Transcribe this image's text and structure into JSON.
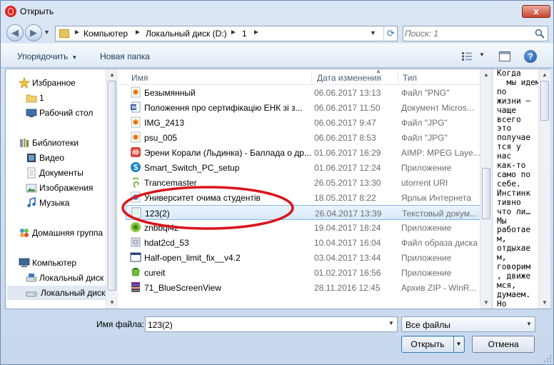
{
  "window": {
    "title": "Открыть",
    "close_label": "x"
  },
  "address": {
    "crumbs": [
      "Компьютер",
      "Локальный диск (D:)",
      "1"
    ],
    "search_placeholder": "Поиск: 1"
  },
  "toolbar": {
    "organize": "Упорядочить",
    "new_folder": "Новая папка"
  },
  "sidebar": {
    "items": [
      {
        "label": "Избранное",
        "icon": "star-icon"
      },
      {
        "label": "1",
        "icon": "folder-icon"
      },
      {
        "label": "Рабочий стол",
        "icon": "desktop-icon"
      },
      {
        "label": "Библиотеки",
        "icon": "library-icon"
      },
      {
        "label": "Видео",
        "icon": "video-icon"
      },
      {
        "label": "Документы",
        "icon": "documents-icon"
      },
      {
        "label": "Изображения",
        "icon": "pictures-icon"
      },
      {
        "label": "Музыка",
        "icon": "music-icon"
      },
      {
        "label": "Домашняя группа",
        "icon": "homegroup-icon"
      },
      {
        "label": "Компьютер",
        "icon": "computer-icon"
      },
      {
        "label": "Локальный диск",
        "icon": "drive-icon"
      },
      {
        "label": "Локальный диск",
        "icon": "drive-icon"
      }
    ]
  },
  "columns": {
    "name": "Имя",
    "date": "Дата изменения",
    "type": "Тип"
  },
  "files": [
    {
      "name": "Безымянный",
      "date": "06.06.2017 13:13",
      "type": "Файл \"PNG\"",
      "icon": "image-file-icon"
    },
    {
      "name": "Положення про сертифікацію ЕНК зі з...",
      "date": "06.06.2017 11:50",
      "type": "Документ Micros...",
      "icon": "word-doc-icon"
    },
    {
      "name": "IMG_2413",
      "date": "06.06.2017 9:47",
      "type": "Файл \"JPG\"",
      "icon": "image-file-icon"
    },
    {
      "name": "psu_005",
      "date": "06.06.2017 8:53",
      "type": "Файл \"JPG\"",
      "icon": "image-file-icon"
    },
    {
      "name": "Эрени Корали (Льдинка) - Баллада о др...",
      "date": "01.06.2017 16:29",
      "type": "AIMP: MPEG Laye...",
      "icon": "audio-file-icon"
    },
    {
      "name": "Smart_Switch_PC_setup",
      "date": "01.06.2017 12:24",
      "type": "Приложение",
      "icon": "smart-switch-icon"
    },
    {
      "name": "Trancemaster",
      "date": "26.05.2017 13:30",
      "type": "utorrent URI",
      "icon": "torrent-icon"
    },
    {
      "name": "Университет очима студентів",
      "date": "18.05.2017 8:22",
      "type": "Ярлык Интернета",
      "icon": "internet-shortcut-icon"
    },
    {
      "name": "123(2)",
      "date": "26.04.2017 13:39",
      "type": "Текстовый докум...",
      "icon": "text-file-icon"
    },
    {
      "name": "znbbql4z",
      "date": "19.04.2017 18:24",
      "type": "Приложение",
      "icon": "app-icon"
    },
    {
      "name": "hdat2cd_53",
      "date": "10.04.2017 16:04",
      "type": "Файл образа диска",
      "icon": "disc-image-icon"
    },
    {
      "name": "Half-open_limit_fix__v4.2",
      "date": "03.04.2017 13:44",
      "type": "Приложение",
      "icon": "exe-icon"
    },
    {
      "name": "cureit",
      "date": "01.02.2017 16:56",
      "type": "Приложение",
      "icon": "cureit-icon"
    },
    {
      "name": "71_BlueScreenView",
      "date": "28.11.2016 12:45",
      "type": "Архив ZIP - WinR...",
      "icon": "archive-icon"
    }
  ],
  "preview": {
    "lines": [
      "Когда",
      "  мы идем",
      "по",
      "жизни –",
      "чаще",
      "всего",
      "это",
      "получае",
      "тся у",
      "нас",
      "как-то",
      "само по",
      "себе.",
      "Инстинк",
      "тивно",
      "что ли…",
      "Мы",
      "работае",
      "м,",
      "отдыхае",
      "м,",
      "говорим",
      ", движе",
      "мся,",
      "думаем.",
      "Но"
    ]
  },
  "footer": {
    "filename_label": "Имя файла:",
    "filename_value": "123(2)",
    "filetype": "Все файлы",
    "open": "Открыть",
    "cancel": "Отмена"
  },
  "annotation": {
    "color": "#d9151b"
  }
}
